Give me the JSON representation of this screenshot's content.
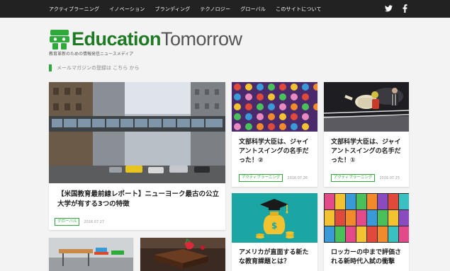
{
  "nav": {
    "items": [
      "アクティブラーニング",
      "イノベーション",
      "ブランディング",
      "テクノロジー",
      "グローバル",
      "このサイトについて"
    ],
    "twitter": "twitter-icon",
    "facebook": "facebook-icon"
  },
  "brand": {
    "logo_bold": "Education",
    "logo_light": "Tomorrow",
    "tagline": "教育革新のための情報発信ニュースメディア"
  },
  "mail": {
    "text": "メールマガジンの登録は こちら から"
  },
  "articles": [
    {
      "title": "【米国教育最前線レポート】ニューヨーク最古の公立大学が有する3つの特徴",
      "tag": "グローバル",
      "date": "2016.07.27"
    },
    {
      "title": "文部科学大臣は、ジャイアントスイングの名手だった！②",
      "tag": "アクティブラーニング",
      "date": "2016.07.26"
    },
    {
      "title": "文部科学大臣は、ジャイアントスイングの名手だった！①",
      "tag": "アクティブラーニング",
      "date": "2016.07.25"
    },
    {
      "title": "アメリカが直面する新たな教育課題とは？"
    },
    {
      "title": "ロッカーの中まで評価される新時代入試の衝撃"
    }
  ],
  "colors": {
    "accent": "#2eaa3a",
    "brand": "#1d7a23",
    "topbar": "#222222"
  }
}
